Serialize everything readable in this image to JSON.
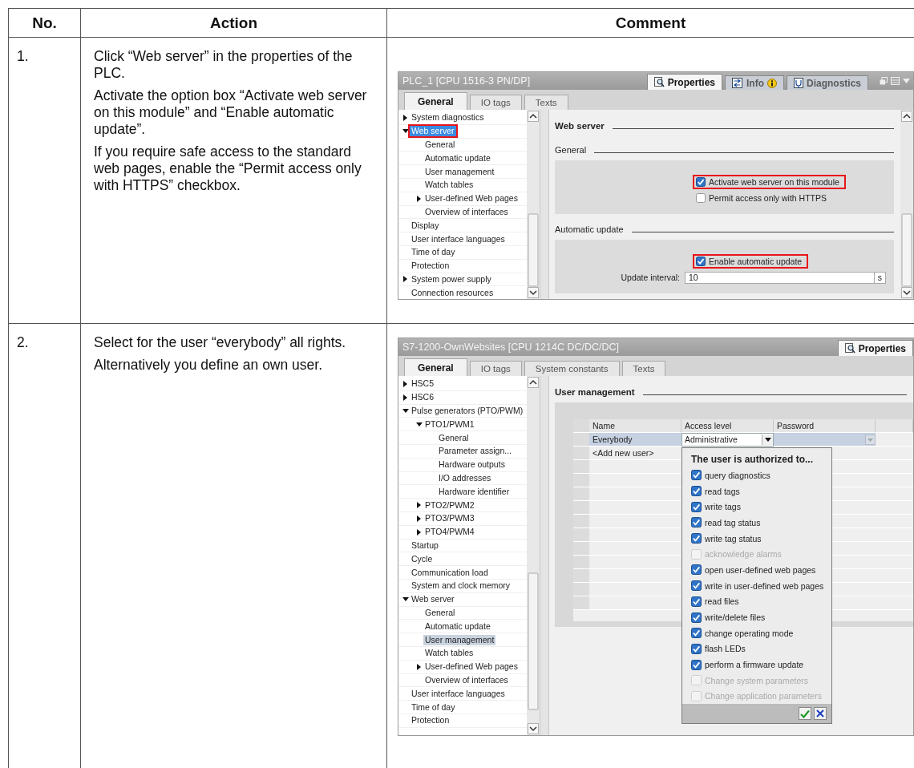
{
  "table": {
    "columns": [
      "No.",
      "Action",
      "Comment"
    ],
    "rows": [
      {
        "number": "1.",
        "action": [
          "Click “Web server” in the properties of the PLC.",
          "Activate the option box “Activate web server on this module” and “Enable automatic update”.",
          "If you require safe access to the standard web pages, enable the “Permit access only with HTTPS” checkbox."
        ],
        "screenshot": {
          "kind": "settings",
          "title": "PLC_1 [CPU 1516-3 PN/DP]",
          "tree_focused": true,
          "inspector_tabs": [
            {
              "label": "Properties",
              "selected": true
            },
            {
              "label": "Info",
              "selected": false
            },
            {
              "label": "Diagnostics",
              "selected": false
            }
          ],
          "tabs": [
            {
              "label": "General",
              "selected": true
            },
            {
              "label": "IO tags",
              "selected": false
            },
            {
              "label": "Texts",
              "selected": false
            }
          ],
          "tree": [
            {
              "label": "System diagnostics",
              "expanded": false,
              "selected": false,
              "highlighted": false
            },
            {
              "label": "Web server",
              "expanded": true,
              "selected": true,
              "highlighted": true,
              "children": [
                {
                  "label": "General",
                  "selected": false,
                  "highlighted": false
                },
                {
                  "label": "Automatic update",
                  "selected": false,
                  "highlighted": false
                },
                {
                  "label": "User management",
                  "selected": false,
                  "highlighted": false
                },
                {
                  "label": "Watch tables",
                  "selected": false,
                  "highlighted": false
                },
                {
                  "label": "User-defined Web pages",
                  "expanded": false,
                  "selected": false,
                  "highlighted": false
                },
                {
                  "label": "Overview of interfaces",
                  "selected": false,
                  "highlighted": false
                }
              ]
            },
            {
              "label": "Display",
              "selected": false,
              "highlighted": false
            },
            {
              "label": "User interface languages",
              "selected": false,
              "highlighted": false
            },
            {
              "label": "Time of day",
              "selected": false,
              "highlighted": false
            },
            {
              "label": "Protection",
              "selected": false,
              "highlighted": false
            },
            {
              "label": "System power supply",
              "expanded": false,
              "selected": false,
              "highlighted": false
            },
            {
              "label": "Connection resources",
              "selected": false,
              "highlighted": false
            }
          ],
          "heading": "Web server",
          "sections": [
            {
              "title": "General",
              "checkboxes": [
                {
                  "label": "Activate web server on this module",
                  "checked": true,
                  "highlighted": true
                },
                {
                  "label": "Permit access only with HTTPS",
                  "checked": false,
                  "highlighted": false
                }
              ]
            },
            {
              "title": "Automatic update",
              "checkboxes": [
                {
                  "label": "Enable automatic update",
                  "checked": true,
                  "highlighted": true
                }
              ],
              "field": {
                "label": "Update interval:",
                "value": "10",
                "unit": "s"
              }
            }
          ]
        }
      },
      {
        "number": "2.",
        "action": [
          "Select for the user “everybody” all rights.",
          "Alternatively you define an own user."
        ],
        "screenshot": {
          "kind": "user_management",
          "title": "S7-1200-OwnWebsites [CPU 1214C DC/DC/DC]",
          "tree_focused": false,
          "inspector_tabs": [
            {
              "label": "Properties",
              "selected": true
            }
          ],
          "tabs": [
            {
              "label": "General",
              "selected": true
            },
            {
              "label": "IO tags",
              "selected": false
            },
            {
              "label": "System constants",
              "selected": false
            },
            {
              "label": "Texts",
              "selected": false
            }
          ],
          "tree": [
            {
              "label": "HSC5",
              "expanded": false,
              "selected": false
            },
            {
              "label": "HSC6",
              "expanded": false,
              "selected": false
            },
            {
              "label": "Pulse generators (PTO/PWM)",
              "expanded": true,
              "selected": false,
              "children": [
                {
                  "label": "PTO1/PWM1",
                  "expanded": true,
                  "selected": false,
                  "children": [
                    {
                      "label": "General",
                      "selected": false
                    },
                    {
                      "label": "Parameter assign...",
                      "selected": false
                    },
                    {
                      "label": "Hardware outputs",
                      "selected": false
                    },
                    {
                      "label": "I/O addresses",
                      "selected": false
                    },
                    {
                      "label": "Hardware identifier",
                      "selected": false
                    }
                  ]
                },
                {
                  "label": "PTO2/PWM2",
                  "expanded": false,
                  "selected": false
                },
                {
                  "label": "PTO3/PWM3",
                  "expanded": false,
                  "selected": false
                },
                {
                  "label": "PTO4/PWM4",
                  "expanded": false,
                  "selected": false
                }
              ]
            },
            {
              "label": "Startup",
              "selected": false
            },
            {
              "label": "Cycle",
              "selected": false
            },
            {
              "label": "Communication load",
              "selected": false
            },
            {
              "label": "System and clock memory",
              "selected": false
            },
            {
              "label": "Web server",
              "expanded": true,
              "selected": false,
              "children": [
                {
                  "label": "General",
                  "selected": false
                },
                {
                  "label": "Automatic update",
                  "selected": false
                },
                {
                  "label": "User management",
                  "selected": true
                },
                {
                  "label": "Watch tables",
                  "selected": false
                },
                {
                  "label": "User-defined Web pages",
                  "expanded": false,
                  "selected": false
                },
                {
                  "label": "Overview of interfaces",
                  "selected": false
                }
              ]
            },
            {
              "label": "User interface languages",
              "selected": false
            },
            {
              "label": "Time of day",
              "selected": false
            },
            {
              "label": "Protection",
              "selected": false
            }
          ],
          "heading": "User management",
          "user_table": {
            "columns": [
              "Name",
              "Access level",
              "Password"
            ],
            "rows": [
              {
                "name": "Everybody",
                "access_level": "Administrative",
                "selected": true
              },
              {
                "name": "<Add new user>",
                "selected": false
              }
            ]
          },
          "popup": {
            "title": "The user is authorized to...",
            "options": [
              {
                "label": "query diagnostics",
                "checked": true,
                "disabled": false
              },
              {
                "label": "read tags",
                "checked": true,
                "disabled": false
              },
              {
                "label": "write tags",
                "checked": true,
                "disabled": false
              },
              {
                "label": "read tag status",
                "checked": true,
                "disabled": false
              },
              {
                "label": "write tag status",
                "checked": true,
                "disabled": false
              },
              {
                "label": "acknowledge alarms",
                "disabled": true
              },
              {
                "label": "open user-defined web pages",
                "checked": true,
                "disabled": false
              },
              {
                "label": "write in user-defined web pages",
                "checked": true,
                "disabled": false
              },
              {
                "label": "read files",
                "checked": true,
                "disabled": false
              },
              {
                "label": "write/delete files",
                "checked": true,
                "disabled": false
              },
              {
                "label": "change operating mode",
                "checked": true,
                "disabled": false
              },
              {
                "label": "flash LEDs",
                "checked": true,
                "disabled": false
              },
              {
                "label": "perform a firmware update",
                "checked": true,
                "disabled": false
              },
              {
                "label": "Change system parameters",
                "disabled": true
              },
              {
                "label": "Change application parameters",
                "disabled": true
              }
            ]
          }
        }
      }
    ]
  }
}
